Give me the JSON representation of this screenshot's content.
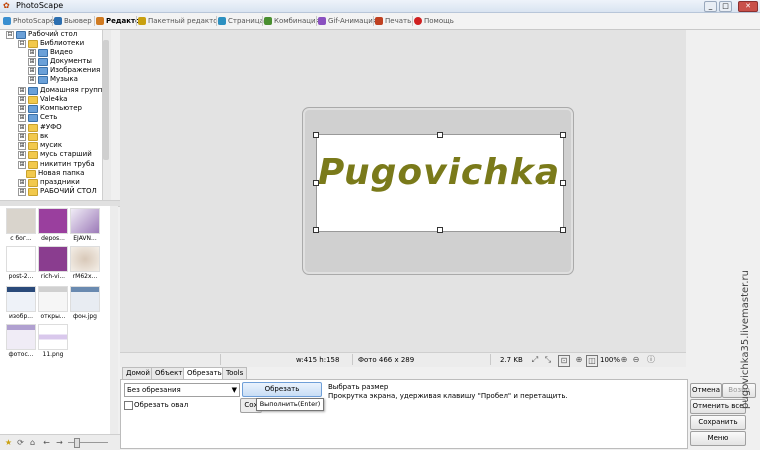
{
  "window": {
    "title": "PhotoScape",
    "minimize": "_",
    "maximize": "□",
    "close": "✕"
  },
  "tabs": [
    {
      "label": "PhotoScape",
      "icon": "photoscape-icon",
      "color": "#3a8fd0"
    },
    {
      "label": "Вьювер",
      "icon": "viewer-icon",
      "color": "#2c6fb0"
    },
    {
      "label": "Редактор",
      "icon": "editor-icon",
      "color": "#d07a20",
      "active": true
    },
    {
      "label": "Пакетный редактор",
      "icon": "batch-editor-icon",
      "color": "#c9a010"
    },
    {
      "label": "Страница",
      "icon": "page-icon",
      "color": "#2c90c0"
    },
    {
      "label": "Комбинация",
      "icon": "combine-icon",
      "color": "#4a8f30"
    },
    {
      "label": "Gif-Анимация",
      "icon": "gif-icon",
      "color": "#8a50c0"
    },
    {
      "label": "Печать",
      "icon": "print-icon",
      "color": "#c04020"
    },
    {
      "label": "Помощь",
      "icon": "help-icon",
      "color": "#d02020"
    }
  ],
  "tree": [
    {
      "label": "Рабочий стол",
      "expander": "⊟"
    },
    {
      "label": "Библиотеки",
      "expander": "⊟"
    },
    {
      "label": "Видео",
      "expander": "⊞"
    },
    {
      "label": "Документы",
      "expander": "⊞"
    },
    {
      "label": "Изображения",
      "expander": "⊞"
    },
    {
      "label": "Музыка",
      "expander": "⊞"
    },
    {
      "label": "Домашняя группа",
      "expander": "⊞"
    },
    {
      "label": "Vale4ka",
      "expander": "⊞"
    },
    {
      "label": "Компьютер",
      "expander": "⊞"
    },
    {
      "label": "Сеть",
      "expander": "⊞"
    },
    {
      "label": "#УФО",
      "expander": "⊞"
    },
    {
      "label": "вк",
      "expander": "⊞"
    },
    {
      "label": "мусик",
      "expander": "⊞"
    },
    {
      "label": "мусь старший",
      "expander": "⊞"
    },
    {
      "label": "никитин труба",
      "expander": "⊞"
    },
    {
      "label": "Новая папка",
      "expander": ""
    },
    {
      "label": "праздники",
      "expander": "⊞"
    },
    {
      "label": "РАБОЧИЙ СТОЛ",
      "expander": "⊞"
    }
  ],
  "thumbnails": [
    {
      "caption": "с бог...",
      "color": "#d9d4cc"
    },
    {
      "caption": "depos...",
      "color": "#9a3f9e"
    },
    {
      "caption": "EJAVN...",
      "color": "#e6dff0"
    },
    {
      "caption": "post-2...",
      "color": "#ffffff"
    },
    {
      "caption": "rich-vi...",
      "color": "#8a3d8f"
    },
    {
      "caption": "rM62x...",
      "color": "#efe8e0"
    },
    {
      "caption": "изобр...",
      "color": "#e8eef6"
    },
    {
      "caption": "откры...",
      "color": "#f2f2f2"
    },
    {
      "caption": "фон.jpg",
      "color": "#e4e8ee"
    },
    {
      "caption": "фотос...",
      "color": "#ece8f2"
    },
    {
      "caption": "11.png",
      "color": "#d9c8ec"
    }
  ],
  "canvas": {
    "photo_text": "Pugovichka"
  },
  "status": {
    "size": "w:415 h:158",
    "photo_info": "Фото 466 x 289",
    "file_size": "2.7 KB",
    "zoom": "100%"
  },
  "subtabs": [
    "Домой",
    "Объект",
    "Обрезать",
    "Tools"
  ],
  "crop": {
    "mode": "Без обрезания",
    "oval_label": "Обрезать овал",
    "crop_button": "Обрезать",
    "second_button": "Сох",
    "tooltip": "Выполнить(Enter)",
    "hint_title": "Выбрать размер",
    "hint_text": "Прокрутка экрана, удерживая клавишу \"Пробел\" и перетащить."
  },
  "actions": {
    "undo": "Отмена",
    "redo": "Возвр",
    "undo_all": "Отменить все",
    "save": "Сохранить",
    "menu": "Меню"
  },
  "watermark": "pugovichka35.livemaster.ru"
}
